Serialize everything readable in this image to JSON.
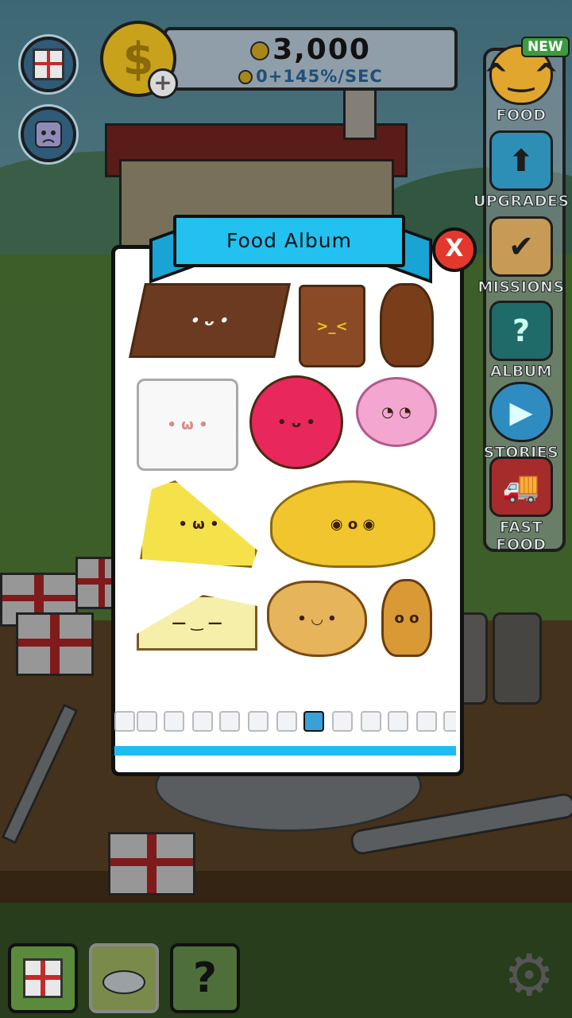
{
  "header": {
    "money": "3,000",
    "rate_prefix": "0",
    "rate_suffix": "+145%/SEC",
    "dollar_symbol": "$",
    "plus_symbol": "+"
  },
  "sidebar": {
    "new_badge": "NEW",
    "items": [
      {
        "label": "FOOD",
        "icon": "taco-icon"
      },
      {
        "label": "UPGRADES",
        "icon": "upgrade-arrow-icon"
      },
      {
        "label": "MISSIONS",
        "icon": "clipboard-icon"
      },
      {
        "label": "ALBUM",
        "icon": "album-book-icon"
      },
      {
        "label": "STORIES",
        "icon": "play-icon"
      },
      {
        "label": "FAST FOOD",
        "icon": "truck-icon"
      }
    ]
  },
  "dialog": {
    "title": "Food Album",
    "close_label": "X"
  },
  "colors": {
    "accent": "#22c1f0",
    "close": "#e4382c",
    "dialog_bg": "#ffffff"
  },
  "album_foods": [
    "brownie-icon",
    "chocolate-milk-icon",
    "chocolate-bunny-icon",
    "sugar-cube-icon",
    "gumball-icon",
    "cotton-candy-icon",
    "cheese-wedge-icon",
    "cheese-wheel-icon",
    "cheesecake-icon",
    "chicken-nugget-icon",
    "fried-chicken-icon"
  ],
  "bottom_bar": {
    "help_symbol": "?"
  }
}
